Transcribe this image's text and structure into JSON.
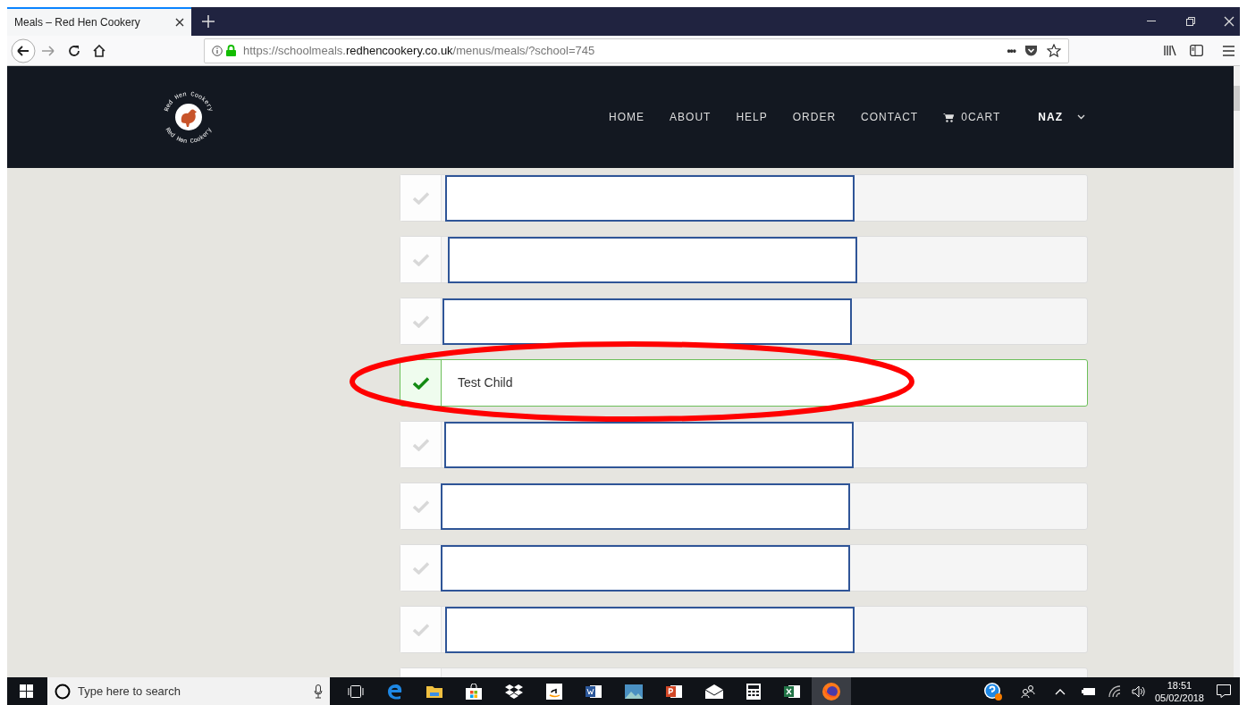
{
  "browser": {
    "tab_title": "Meals – Red Hen Cookery",
    "url_prefix": "https://schoolmeals.",
    "url_domain": "redhencookery.co.uk",
    "url_path": "/menus/meals/?school=745",
    "overflow_menu": "•••"
  },
  "site": {
    "logo_top": "Red Hen Cookery",
    "logo_bottom": "Red Hen Cookery",
    "nav": [
      {
        "label": "HOME"
      },
      {
        "label": "ABOUT"
      },
      {
        "label": "HELP"
      },
      {
        "label": "ORDER"
      },
      {
        "label": "CONTACT"
      }
    ],
    "cart": "0CART",
    "user": "NAZ"
  },
  "children": [
    {
      "selected": false,
      "redacted": true
    },
    {
      "selected": false,
      "redacted": true
    },
    {
      "selected": false,
      "redacted": true
    },
    {
      "selected": true,
      "redacted": false,
      "name": "Test Child"
    },
    {
      "selected": false,
      "redacted": true
    },
    {
      "selected": false,
      "redacted": true
    },
    {
      "selected": false,
      "redacted": true
    },
    {
      "selected": false,
      "redacted": true
    },
    {
      "selected": false,
      "redacted": false
    }
  ],
  "taskbar": {
    "search_placeholder": "Type here to search",
    "time": "18:51",
    "date": "05/02/2018"
  }
}
